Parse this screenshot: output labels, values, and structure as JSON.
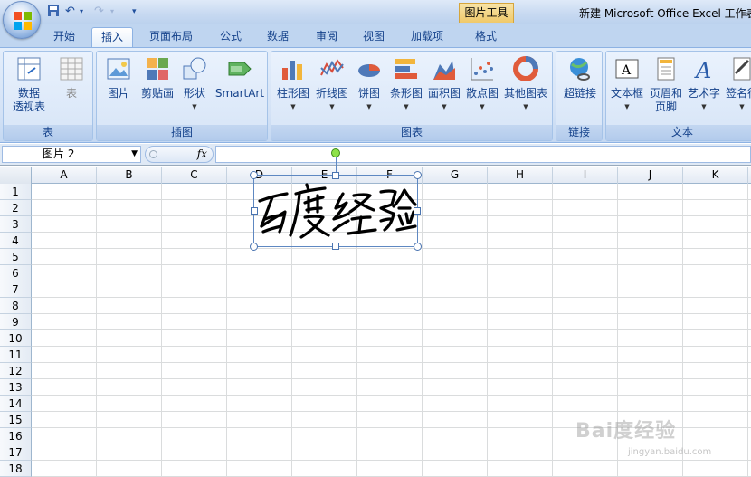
{
  "window": {
    "title": "新建 Microsoft Office Excel 工作表",
    "contextual_tab": "图片工具"
  },
  "tabs": [
    {
      "label": "开始"
    },
    {
      "label": "插入",
      "active": true
    },
    {
      "label": "页面布局"
    },
    {
      "label": "公式"
    },
    {
      "label": "数据"
    },
    {
      "label": "审阅"
    },
    {
      "label": "视图"
    },
    {
      "label": "加载项"
    },
    {
      "label": "格式"
    }
  ],
  "ribbon": {
    "groups": {
      "table": "表",
      "illustrations": "插图",
      "charts": "图表",
      "links": "链接",
      "text": "文本"
    },
    "buttons": {
      "pivot_line1": "数据",
      "pivot_line2": "透视表",
      "table": "表",
      "picture": "图片",
      "clipart": "剪贴画",
      "shapes": "形状",
      "smartart": "SmartArt",
      "column": "柱形图",
      "line": "折线图",
      "pie": "饼图",
      "bar": "条形图",
      "area": "面积图",
      "scatter": "散点图",
      "other": "其他图表",
      "hyperlink": "超链接",
      "textbox": "文本框",
      "header_line1": "页眉和",
      "header_line2": "页脚",
      "wordart": "艺术字",
      "signature": "签名行"
    }
  },
  "formula_bar": {
    "name_box": "图片 2",
    "fx": "fx",
    "value": ""
  },
  "sheet": {
    "columns": [
      "A",
      "B",
      "C",
      "D",
      "E",
      "F",
      "G",
      "H",
      "I",
      "J",
      "K"
    ],
    "rows": [
      "1",
      "2",
      "3",
      "4",
      "5",
      "6",
      "7",
      "8",
      "9",
      "10",
      "11",
      "12",
      "13",
      "14",
      "15",
      "16",
      "17",
      "18"
    ]
  },
  "picture": {
    "text": "百度经验"
  },
  "watermark": {
    "brand": "Bai度经验",
    "url": "jingyan.baidu.com"
  },
  "colors": {
    "tab_text": "#15428b",
    "ribbon_bg": "#dae7f8",
    "tools_tab": "#f0c96a",
    "selection": "#5e88c2",
    "rotate_handle": "#8ee24a"
  }
}
